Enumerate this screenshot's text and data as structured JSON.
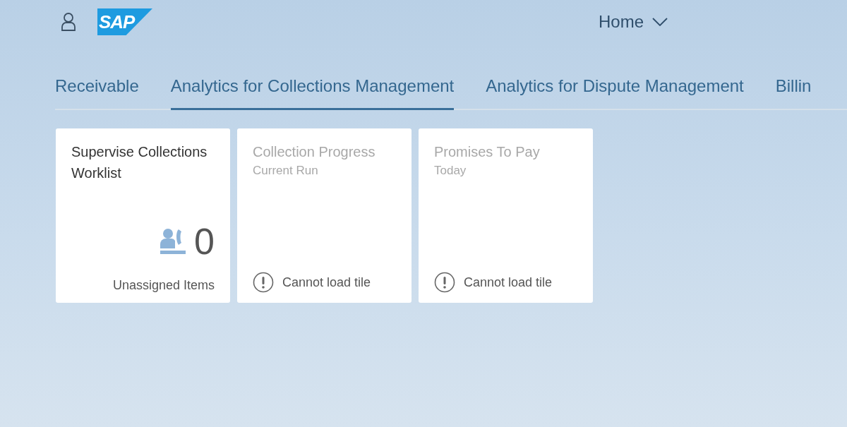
{
  "header": {
    "logo": "SAP",
    "title": "Home"
  },
  "tabs": [
    {
      "label": "Receivable",
      "selected": false
    },
    {
      "label": "Analytics for Collections Management",
      "selected": true
    },
    {
      "label": "Analytics for Dispute Management",
      "selected": false
    },
    {
      "label": "Billin",
      "selected": false
    }
  ],
  "tiles": [
    {
      "kind": "kpi",
      "title": "Supervise Collections Worklist",
      "value": "0",
      "footer": "Unassigned Items"
    },
    {
      "kind": "error",
      "title": "Collection Progress",
      "subtitle": "Current Run",
      "footer": "Cannot load tile"
    },
    {
      "kind": "error",
      "title": "Promises To Pay",
      "subtitle": "Today",
      "footer": "Cannot load tile"
    }
  ]
}
